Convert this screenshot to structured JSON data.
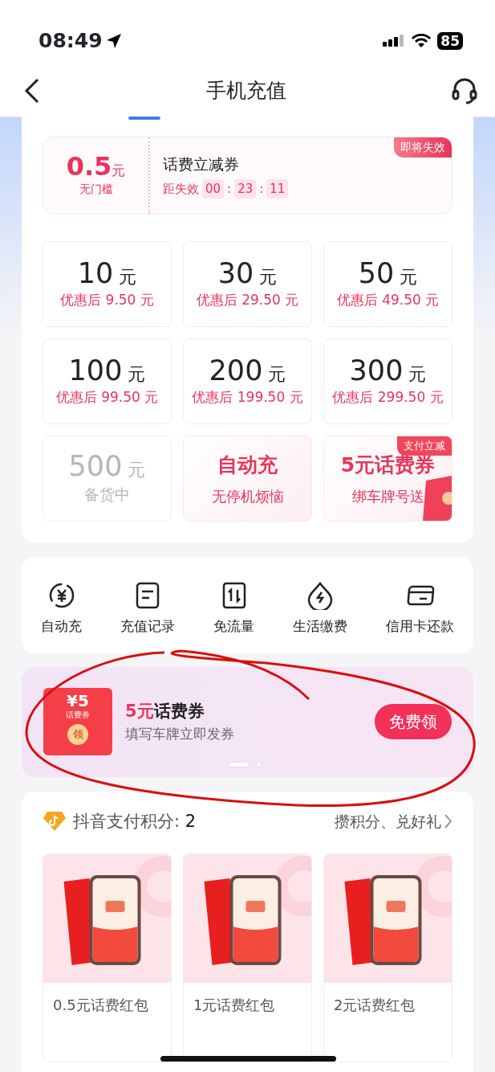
{
  "status_bar": {
    "time": "08:49",
    "battery": "85"
  },
  "nav": {
    "title": "手机充值"
  },
  "coupon": {
    "amount": "0.5",
    "unit": "元",
    "condition": "无门槛",
    "title": "话费立减券",
    "countdown_label": "距失效",
    "countdown": [
      "00",
      "23",
      "11"
    ],
    "countdown_separator": ":",
    "tag": "即将失效"
  },
  "amounts": [
    {
      "kind": "amount",
      "value": "10",
      "unit": "元",
      "note": "优惠后 9.50 元",
      "disabled": false
    },
    {
      "kind": "amount",
      "value": "30",
      "unit": "元",
      "note": "优惠后 29.50 元",
      "disabled": false
    },
    {
      "kind": "amount",
      "value": "50",
      "unit": "元",
      "note": "优惠后 49.50 元",
      "disabled": false
    },
    {
      "kind": "amount",
      "value": "100",
      "unit": "元",
      "note": "优惠后 99.50 元",
      "disabled": false
    },
    {
      "kind": "amount",
      "value": "200",
      "unit": "元",
      "note": "优惠后 199.50 元",
      "disabled": false
    },
    {
      "kind": "amount",
      "value": "300",
      "unit": "元",
      "note": "优惠后 299.50 元",
      "disabled": false
    },
    {
      "kind": "amount",
      "value": "500",
      "unit": "元",
      "note": "备货中",
      "disabled": true
    }
  ],
  "promos": [
    {
      "kind": "promo",
      "title": "自动充",
      "note": "无停机烦恼"
    },
    {
      "kind": "promo_tag",
      "title": "5元话费券",
      "note": "绑车牌号送",
      "tag": "支付立减"
    }
  ],
  "services": [
    {
      "kind": "yuan",
      "label": "自动充"
    },
    {
      "kind": "record",
      "label": "充值记录"
    },
    {
      "kind": "data",
      "label": "免流量"
    },
    {
      "kind": "bolt",
      "label": "生活缴费"
    },
    {
      "kind": "card",
      "label": "信用卡还款"
    }
  ],
  "banner": {
    "badge_amount": "¥5",
    "badge_label": "话费券",
    "badge_button": "领",
    "title": "**5元**话费券",
    "subtitle": "填写车牌立即发券",
    "button": "免费领",
    "dots": [
      {
        "selected": true
      },
      {
        "selected": false
      }
    ]
  },
  "points": {
    "label": "抖音支付积分:",
    "value": "2",
    "link": "攒积分、兑好礼",
    "items": [
      {
        "kind": "picture",
        "label": "0.5元话费红包"
      },
      {
        "kind": "picture",
        "label": "1元话费红包"
      },
      {
        "kind": "picture",
        "label": "2元话费红包"
      }
    ]
  }
}
